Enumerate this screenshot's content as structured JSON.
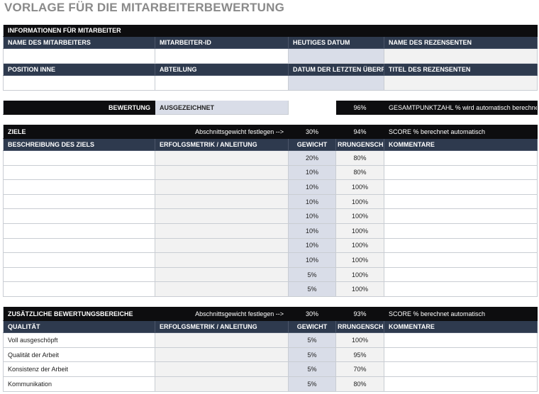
{
  "title": "VORLAGE FÜR DIE MITARBEITERBEWERTUNG",
  "employee_info": {
    "header": "INFORMATIONEN FÜR MITARBEITER",
    "labels_row1": [
      "NAME DES MITARBEITERS",
      "MITARBEITER-ID",
      "HEUTIGES DATUM",
      "NAME DES REZENSENTEN"
    ],
    "labels_row2": [
      "POSITION INNE",
      "ABTEILUNG",
      "DATUM DER LETZTEN ÜBERPRÜ",
      "TITEL DES REZENSENTEN"
    ]
  },
  "rating": {
    "label": "BEWERTUNG",
    "value": "AUSGEZEICHNET",
    "total_percent": "96%",
    "total_label": "GESAMTPUNKTZAHL  % wird automatisch berechnet"
  },
  "goals": {
    "header": "ZIELE",
    "weight_hint": "Abschnittsgewicht festlegen -->",
    "section_weight": "30%",
    "score": "94%",
    "score_label": "SCORE  % berechnet automatisch",
    "columns": [
      "BESCHREIBUNG DES ZIELS",
      "ERFOLGSMETRIK / ANLEITUNG",
      "GEWICHT",
      "RRUNGENSCHAF",
      "KOMMENTARE"
    ],
    "rows": [
      {
        "weight": "20%",
        "achievement": "80%"
      },
      {
        "weight": "10%",
        "achievement": "80%"
      },
      {
        "weight": "10%",
        "achievement": "100%"
      },
      {
        "weight": "10%",
        "achievement": "100%"
      },
      {
        "weight": "10%",
        "achievement": "100%"
      },
      {
        "weight": "10%",
        "achievement": "100%"
      },
      {
        "weight": "10%",
        "achievement": "100%"
      },
      {
        "weight": "10%",
        "achievement": "100%"
      },
      {
        "weight": "5%",
        "achievement": "100%"
      },
      {
        "weight": "5%",
        "achievement": "100%"
      }
    ]
  },
  "additional": {
    "header": "ZUSÄTZLICHE BEWERTUNGSBEREICHE",
    "weight_hint": "Abschnittsgewicht festlegen -->",
    "section_weight": "30%",
    "score": "93%",
    "score_label": "SCORE  % berechnet automatisch",
    "columns": [
      "QUALITÄT",
      "ERFOLGSMETRIK / ANLEITUNG",
      "GEWICHT",
      "RRUNGENSCHAF",
      "KOMMENTARE"
    ],
    "rows": [
      {
        "name": "Voll ausgeschöpft",
        "weight": "5%",
        "achievement": "100%"
      },
      {
        "name": "Qualität der Arbeit",
        "weight": "5%",
        "achievement": "95%"
      },
      {
        "name": "Konsistenz der Arbeit",
        "weight": "5%",
        "achievement": "70%"
      },
      {
        "name": "Kommunikation",
        "weight": "5%",
        "achievement": "80%"
      }
    ]
  }
}
